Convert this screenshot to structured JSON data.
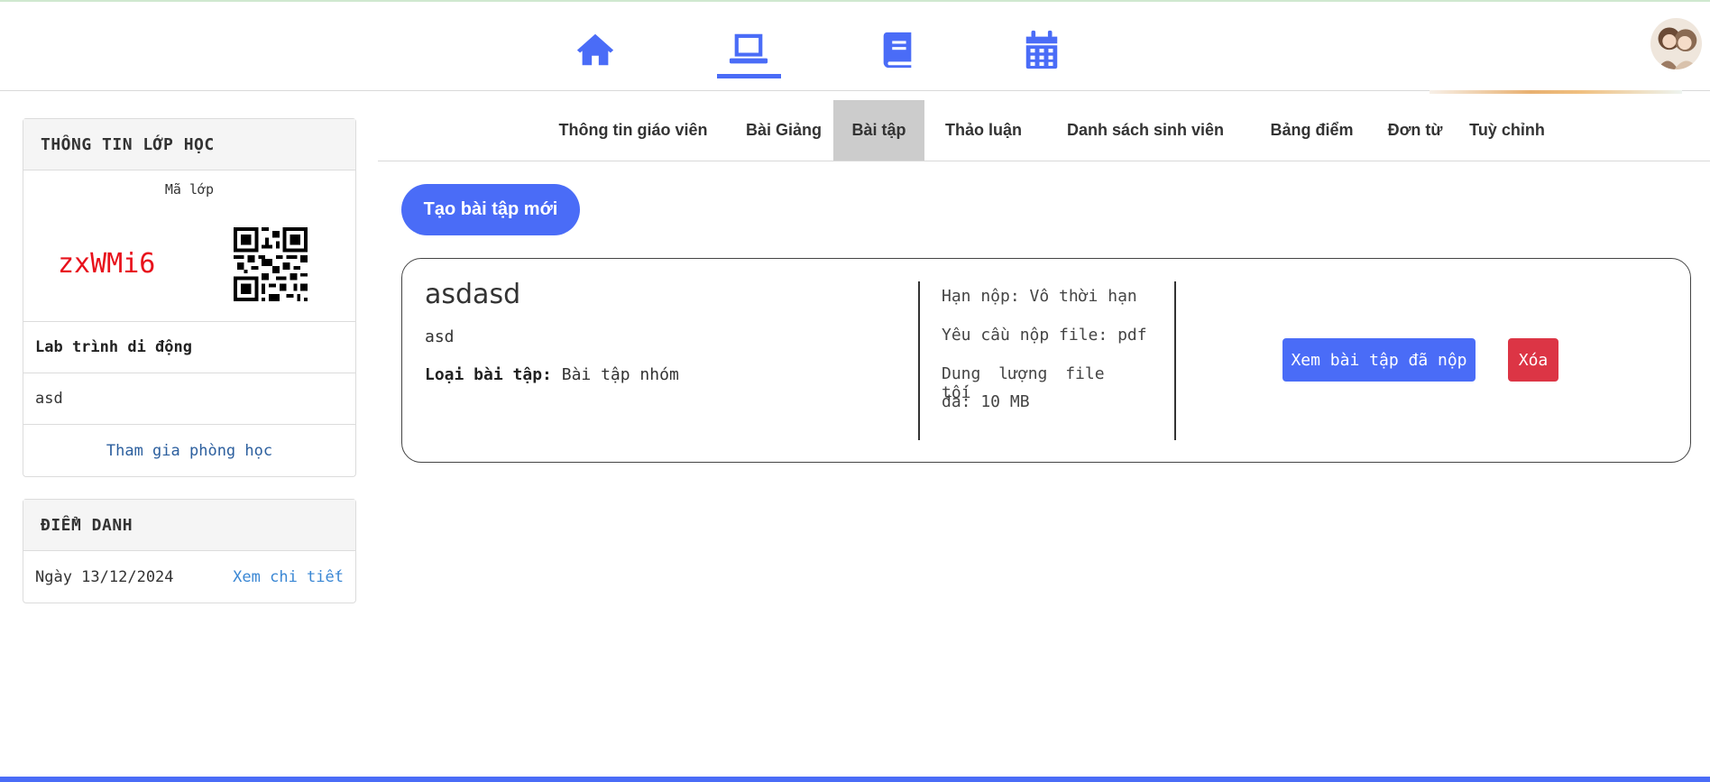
{
  "nav": {
    "icons": [
      "home-icon",
      "laptop-icon",
      "book-icon",
      "calendar-icon"
    ],
    "active": "laptop-icon"
  },
  "class_info": {
    "header": "THÔNG TIN LỚP HỌC",
    "code_label": "Mã lớp",
    "code": "zxWMi6",
    "name": "Lab trình di động",
    "description": "asd",
    "join_link": "Tham gia phòng học"
  },
  "attendance": {
    "header": "ĐIỂM DANH",
    "date": "Ngày 13/12/2024",
    "detail_link": "Xem chi tiết"
  },
  "tabs": [
    {
      "label": "Thông tin giáo viên"
    },
    {
      "label": "Bài Giảng"
    },
    {
      "label": "Bài tập"
    },
    {
      "label": "Thảo luận"
    },
    {
      "label": "Danh sách sinh viên"
    },
    {
      "label": "Bảng điểm"
    },
    {
      "label": "Đơn từ"
    },
    {
      "label": "Tuỳ chỉnh"
    }
  ],
  "active_tab": "Bài tập",
  "create_button": "Tạo bài tập mới",
  "assignment": {
    "title": "asdasd",
    "description": "asd",
    "type_label": "Loại bài tập:",
    "type_value": "Bài tập nhóm",
    "deadline": "Hạn nộp: Vô thời hạn",
    "file_requirement": "Yêu cầu nộp file: pdf",
    "max_size_line1": "Dung lượng file tối",
    "max_size_line2": "đa: 10 MB",
    "view_button": "Xem bài tập đã nộp",
    "delete_button": "Xóa"
  },
  "colors": {
    "primary": "#4a6cf7",
    "danger": "#dc3545",
    "class_code": "#e8111b",
    "link": "#2c5f9e"
  }
}
